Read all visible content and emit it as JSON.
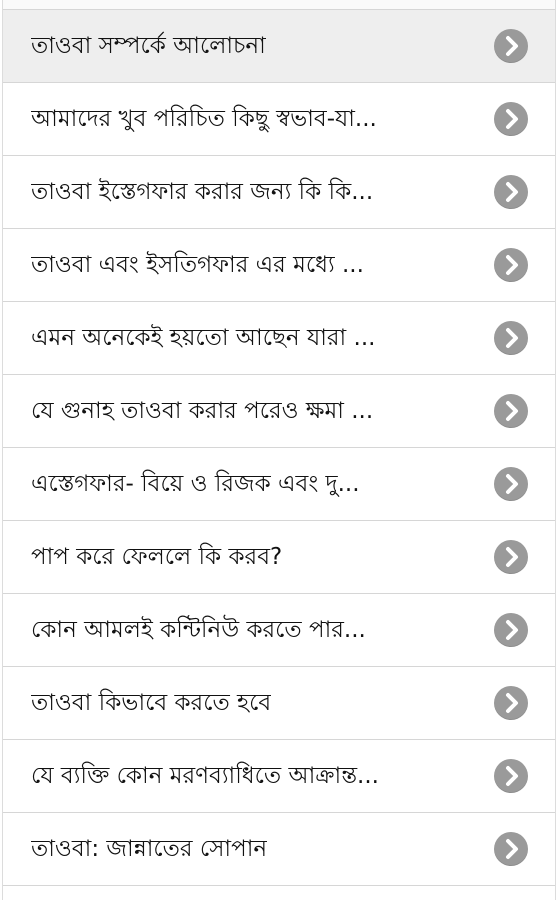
{
  "list": {
    "items": [
      {
        "label": "তাওবা সম্পর্কে আলোচনা",
        "icon": "chevron-right-icon"
      },
      {
        "label": "আমাদের খুব পরিচিত কিছু স্বভাব-যা...",
        "icon": "chevron-right-icon"
      },
      {
        "label": "তাওবা ইস্তেগফার করার জন্য কি কি...",
        "icon": "chevron-right-icon"
      },
      {
        "label": "তাওবা এবং ইসতিগফার এর মধ্যে ...",
        "icon": "chevron-right-icon"
      },
      {
        "label": "এমন অনেকেই হয়তো আছেন যারা ...",
        "icon": "chevron-right-icon"
      },
      {
        "label": "যে গুনাহ তাওবা করার পরেও ক্ষমা ...",
        "icon": "chevron-right-icon"
      },
      {
        "label": "এস্তেগফার- বিয়ে ও রিজক এবং দু...",
        "icon": "chevron-right-icon"
      },
      {
        "label": "পাপ করে ফেললে কি করব?",
        "icon": "chevron-right-icon"
      },
      {
        "label": "কোন আমলই কন্টিনিউ করতে পার...",
        "icon": "chevron-right-icon"
      },
      {
        "label": "তাওবা কিভাবে করতে হবে",
        "icon": "chevron-right-icon"
      },
      {
        "label": "যে ব্যক্তি কোন মরণব্যাধিতে আক্রান্ত...",
        "icon": "chevron-right-icon"
      },
      {
        "label": "তাওবা: জান্নাতের সোপান",
        "icon": "chevron-right-icon"
      }
    ]
  },
  "colors": {
    "selected_row": "#eeeeee",
    "row": "#ffffff",
    "divider": "#d6d6d6",
    "arrow_bg": "#9a9a9a",
    "arrow_fg": "#ffffff",
    "text": "#111111"
  }
}
